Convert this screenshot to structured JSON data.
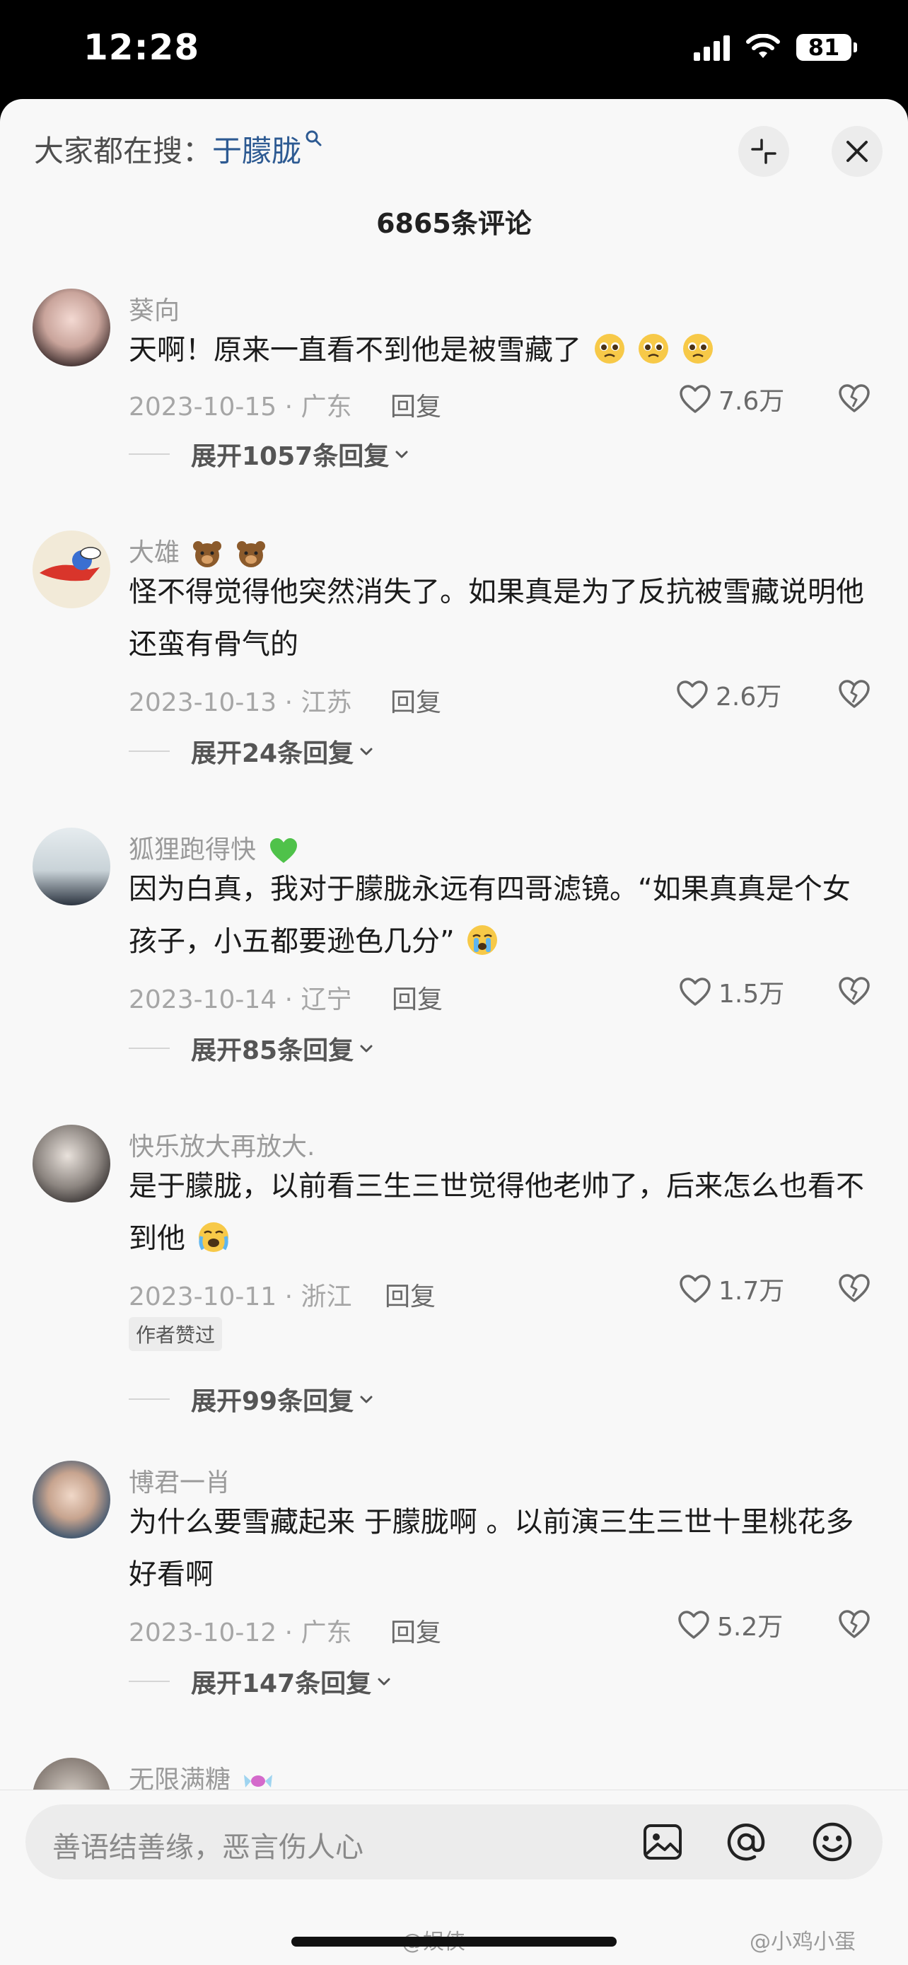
{
  "status": {
    "time": "12:28",
    "battery": "81"
  },
  "header": {
    "search_prefix": "大家都在搜：",
    "search_term": "于朦胧",
    "comment_count": "6865条评论"
  },
  "comments": [
    {
      "user": "葵向",
      "text": "天啊！原来一直看不到他是被雪藏了",
      "date": "2023-10-15 · 广东",
      "reply": "回复",
      "likes": "7.6万",
      "expand": "展开1057条回复"
    },
    {
      "user": "大雄",
      "text": "怪不得觉得他突然消失了。如果真是为了反抗被雪藏说明他还蛮有骨气的",
      "date": "2023-10-13 · 江苏",
      "reply": "回复",
      "likes": "2.6万",
      "expand": "展开24条回复"
    },
    {
      "user": "狐狸跑得快",
      "text": "因为白真，我对于朦胧永远有四哥滤镜。“如果真真是个女孩子，小五都要逊色几分”",
      "date": "2023-10-14 · 辽宁",
      "reply": "回复",
      "likes": "1.5万",
      "expand": "展开85条回复"
    },
    {
      "user": "快乐放大再放大.",
      "text": "是于朦胧，以前看三生三世觉得他老帅了，后来怎么也看不到他",
      "date": "2023-10-11 · 浙江",
      "reply": "回复",
      "likes": "1.7万",
      "tag": "作者赞过",
      "expand": "展开99条回复"
    },
    {
      "user": "博君一肖",
      "text": "为什么要雪藏起来 于朦胧啊 。以前演三生三世十里桃花多好看啊",
      "date": "2023-10-12 · 广东",
      "reply": "回复",
      "likes": "5.2万",
      "expand": "展开147条回复"
    },
    {
      "user": "无限满糖"
    }
  ],
  "input": {
    "placeholder": "善语结善缘，恶言伤人心"
  },
  "watermarks": {
    "left": "@娱侠",
    "right": "@小鸡小蛋"
  },
  "icons": [
    "collapse-icon",
    "close-icon",
    "heart-icon",
    "dislike-icon",
    "chevron-down-icon",
    "image-icon",
    "at-icon",
    "emoji-icon"
  ]
}
